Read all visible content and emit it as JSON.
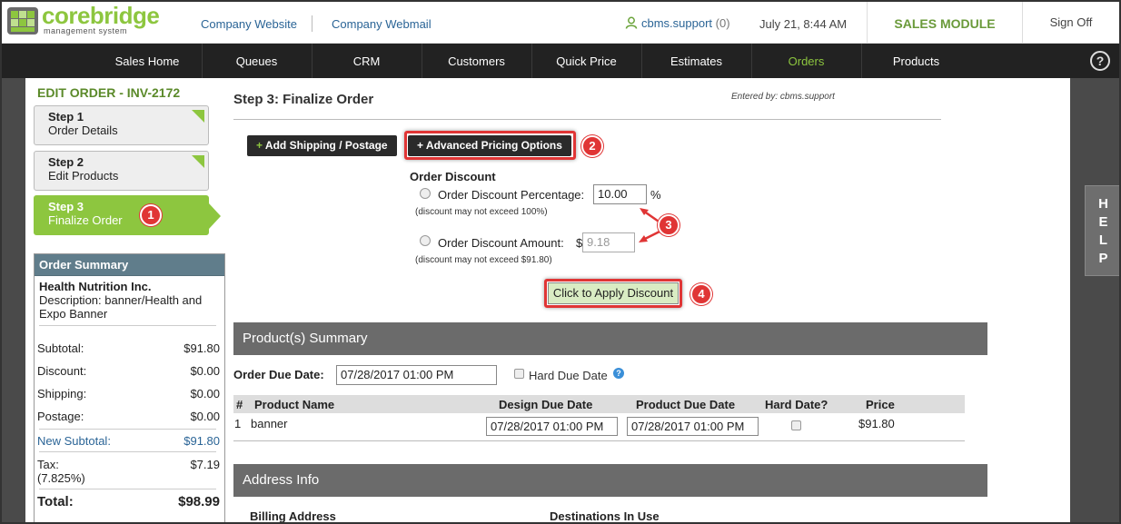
{
  "header": {
    "logo_core": "core",
    "logo_bridge": "bridge",
    "logo_sub": "management system",
    "link_website": "Company Website",
    "link_webmail": "Company Webmail",
    "user": "cbms.support",
    "user_count": "(0)",
    "datetime": "July 21, 8:44 AM",
    "module": "SALES MODULE",
    "signoff": "Sign Off"
  },
  "nav": {
    "items": [
      "Sales Home",
      "Queues",
      "CRM",
      "Customers",
      "Quick Price",
      "Estimates",
      "Orders",
      "Products"
    ],
    "active": "Orders",
    "help_glyph": "?"
  },
  "sidebar": {
    "edit_title": "EDIT ORDER - INV-2172",
    "steps": [
      {
        "title": "Step 1",
        "subtitle": "Order Details"
      },
      {
        "title": "Step 2",
        "subtitle": "Edit Products"
      },
      {
        "title": "Step 3",
        "subtitle": "Finalize Order"
      }
    ],
    "help_tab": [
      "H",
      "E",
      "L",
      "P"
    ]
  },
  "summary": {
    "heading": "Order Summary",
    "customer": "Health Nutrition Inc.",
    "description": "Description:  banner/Health and Expo Banner",
    "rows": [
      {
        "label": "Subtotal:",
        "value": "$91.80"
      },
      {
        "label": "Discount:",
        "value": "$0.00"
      },
      {
        "label": "Shipping:",
        "value": "$0.00"
      },
      {
        "label": "Postage:",
        "value": "$0.00"
      },
      {
        "label": "New Subtotal:",
        "value": "$91.80"
      },
      {
        "label": "Tax:",
        "value": "$7.19"
      },
      {
        "label": "(7.825%)",
        "value": ""
      },
      {
        "label": "Total:",
        "value": "$98.99"
      }
    ]
  },
  "main": {
    "title": "Step 3: Finalize Order",
    "entered_by": "Entered by: cbms.support",
    "btn_shipping": "Add Shipping / Postage",
    "btn_advanced": "Advanced Pricing Options",
    "plus": "+",
    "discount": {
      "title": "Order Discount",
      "pct_label": "Order Discount Percentage:",
      "pct_value": "10.00",
      "pct_unit": "%",
      "pct_note": "(discount may not exceed 100%)",
      "amt_label": "Order Discount Amount:",
      "amt_prefix": "$",
      "amt_value": "9.18",
      "amt_note": "(discount may not exceed $91.80)",
      "apply_button": "Click to Apply Discount"
    },
    "products_band": "Product(s) Summary",
    "due_label": "Order Due Date:",
    "due_value": "07/28/2017 01:00 PM",
    "hard_due_label": "Hard Due Date",
    "help_q": "?",
    "table": {
      "columns": [
        "#",
        "Product Name",
        "Design Due Date",
        "Product Due Date",
        "Hard Date?",
        "Price"
      ],
      "rows": [
        {
          "num": "1",
          "name": "banner",
          "design_due": "07/28/2017 01:00 PM",
          "product_due": "07/28/2017 01:00 PM",
          "price": "$91.80"
        }
      ]
    },
    "address_band": "Address Info",
    "billing_label": "Billing Address",
    "destinations_label": "Destinations In Use"
  },
  "callouts": [
    "1",
    "2",
    "3",
    "4"
  ],
  "colors": {
    "brand_green": "#8dc63f",
    "nav_bg": "#222222",
    "callout_red": "#e03535",
    "summary_head": "#607d8b",
    "band_gray": "#6b6b6b"
  }
}
